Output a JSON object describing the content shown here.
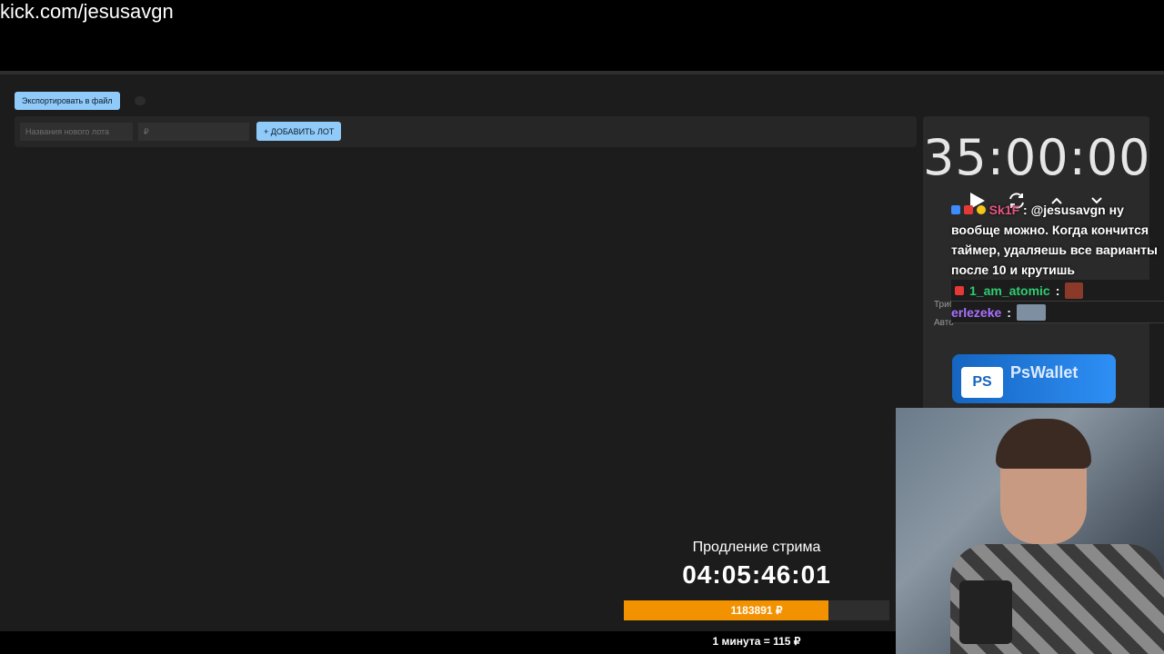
{
  "overlay": {
    "channel_url": "kick.com/jesusavgn"
  },
  "toolbar": {
    "export_label": "Экспортировать в файл"
  },
  "lot_form": {
    "name_placeholder": "Названия нового лота",
    "price_placeholder": "₽",
    "add_label": "+ ДОБАВИТЬ ЛОТ"
  },
  "timer_panel": {
    "time": "35:00:00",
    "label_1": "Триб",
    "label_2": "Авто"
  },
  "chat": {
    "message_user": "Sk1F",
    "message_lines": [
      "@jesusavgn ну",
      "вообще можно. Когда кончится",
      "таймер, удаляешь все варианты",
      "после 10 и крутишь"
    ],
    "rows": [
      {
        "user": "1_am_atomic",
        "color": "#2ecc71"
      },
      {
        "user": "erlezeke",
        "color": "#a970ff"
      }
    ]
  },
  "ad": {
    "card_text": "PS",
    "name": "PsWallet"
  },
  "stream_extension": {
    "title": "Продление стрима",
    "time": "04:05:46:01",
    "amount": "1183891 ₽",
    "progress": 0.77,
    "rate": "1 минута = 115 ₽"
  },
  "colors": {
    "accent": "#90caf9",
    "progress": "#f39200"
  }
}
